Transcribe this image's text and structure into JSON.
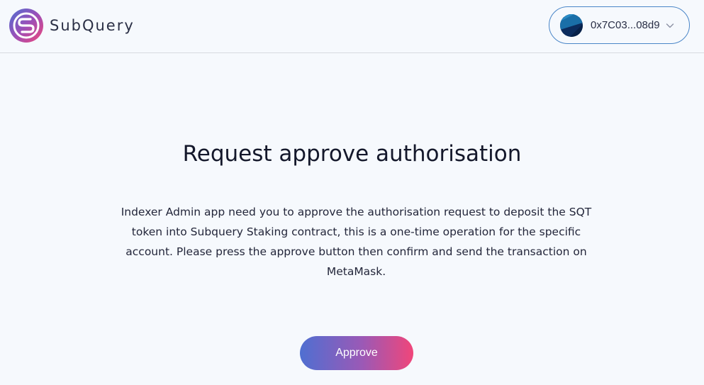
{
  "header": {
    "brand": "SubQuery",
    "account": {
      "address": "0x7C03...08d9"
    }
  },
  "main": {
    "title": "Request approve authorisation",
    "description": "Indexer Admin app need you to approve the authorisation request to deposit the SQT token into Subquery Staking contract, this is a one-time operation for the specific account. Please press the approve button then confirm and send the transaction on MetaMask.",
    "approve_label": "Approve"
  },
  "colors": {
    "accent_start": "#4f6fd1",
    "accent_end": "#f0467a",
    "account_border": "#4a86c8"
  },
  "icons": {
    "logo": "subquery-logo-icon",
    "avatar": "account-avatar",
    "dropdown": "chevron-down-icon"
  }
}
